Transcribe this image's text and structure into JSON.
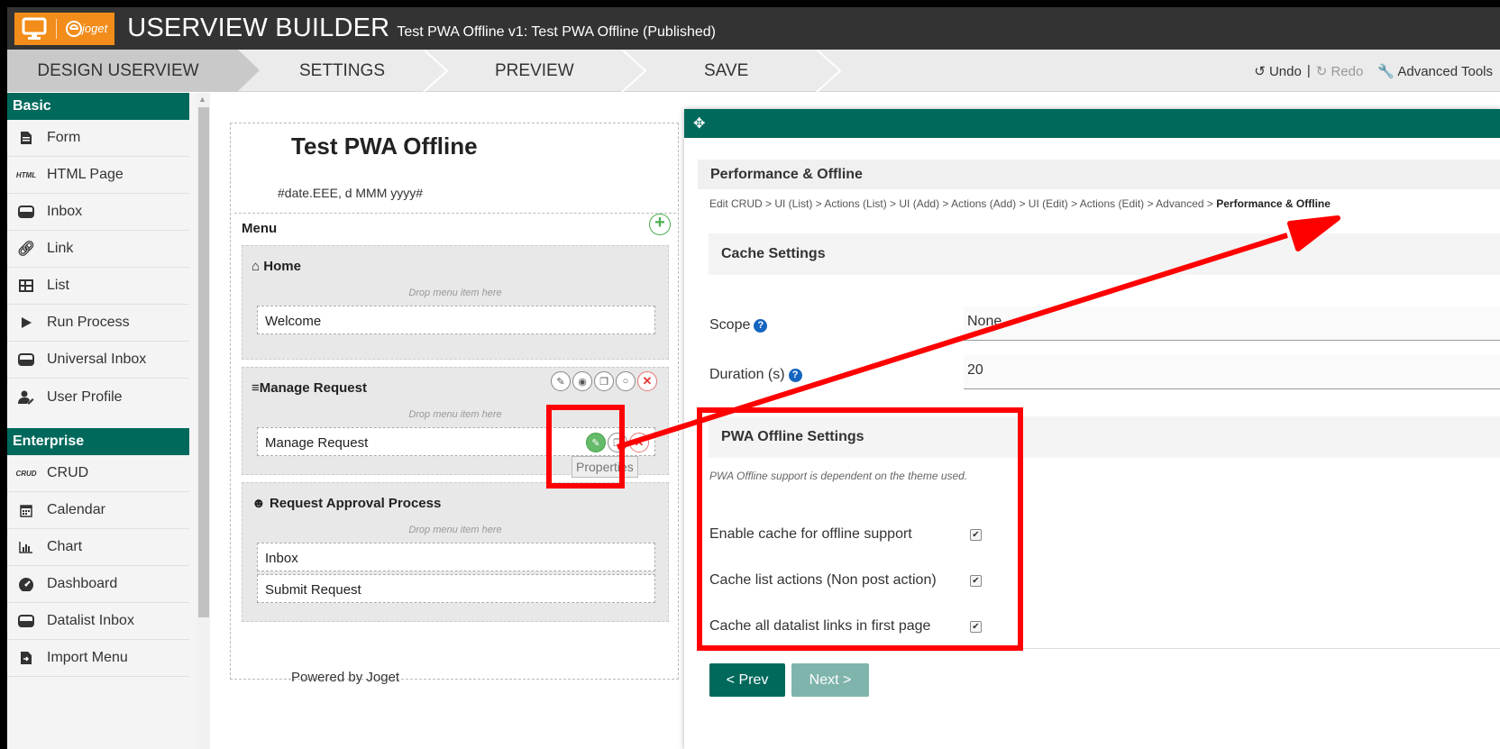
{
  "header": {
    "brand": "joget",
    "title": "USERVIEW BUILDER",
    "subtitle": "Test PWA Offline v1: Test PWA Offline (Published)"
  },
  "steps": [
    "DESIGN USERVIEW",
    "SETTINGS",
    "PREVIEW",
    "SAVE"
  ],
  "tools": {
    "undo": "Undo",
    "separator": "|",
    "redo": "Redo",
    "advanced": "Advanced Tools"
  },
  "palette": {
    "basic_title": "Basic",
    "basic_items": [
      {
        "label": "Form",
        "icon": "form-icon"
      },
      {
        "label": "HTML Page",
        "icon": "html-icon",
        "icon_text": "HTML"
      },
      {
        "label": "Inbox",
        "icon": "inbox-icon"
      },
      {
        "label": "Link",
        "icon": "link-icon"
      },
      {
        "label": "List",
        "icon": "list-icon"
      },
      {
        "label": "Run Process",
        "icon": "play-icon"
      },
      {
        "label": "Universal Inbox",
        "icon": "inbox-icon"
      },
      {
        "label": "User Profile",
        "icon": "user-profile-icon"
      }
    ],
    "enterprise_title": "Enterprise",
    "enterprise_items": [
      {
        "label": "CRUD",
        "icon": "crud-icon",
        "icon_text": "CRUD"
      },
      {
        "label": "Calendar",
        "icon": "calendar-icon"
      },
      {
        "label": "Chart",
        "icon": "chart-icon"
      },
      {
        "label": "Dashboard",
        "icon": "dashboard-icon"
      },
      {
        "label": "Datalist Inbox",
        "icon": "inbox-icon"
      },
      {
        "label": "Import Menu",
        "icon": "import-icon"
      }
    ]
  },
  "canvas": {
    "title": "Test PWA Offline",
    "date": "#date.EEE, d MMM yyyy#",
    "menu_label": "Menu",
    "drop_hint": "Drop menu item here",
    "categories": [
      {
        "title": "Home",
        "items": [
          "Welcome"
        ]
      },
      {
        "title": "Manage Request",
        "items": [
          "Manage Request"
        ]
      },
      {
        "title": "Request Approval Process",
        "items": [
          "Inbox",
          "Submit Request"
        ]
      }
    ],
    "footer": "Powered by Joget",
    "tooltip": "Properties"
  },
  "panel": {
    "section_title": "Performance & Offline",
    "breadcrumb": "Edit CRUD > UI (List) > Actions (List) > UI (Add) > Actions (Add) > UI (Edit) > Actions (Edit) > Advanced > ",
    "breadcrumb_current": "Performance & Offline",
    "cache_title": "Cache Settings",
    "scope_label": "Scope",
    "scope_value": "None",
    "duration_label": "Duration (s)",
    "duration_value": "20",
    "pwa_title": "PWA Offline Settings",
    "pwa_note": "PWA Offline support is dependent on the theme used.",
    "options": [
      {
        "label": "Enable cache for offline support",
        "checked": true
      },
      {
        "label": "Cache list actions (Non post action)",
        "checked": true
      },
      {
        "label": "Cache all datalist links in first page",
        "checked": true
      }
    ],
    "prev": "< Prev",
    "next": "Next >"
  },
  "colors": {
    "accent": "#00695c",
    "header": "#333333",
    "logo": "#f28c1a",
    "annotation": "#ff0000"
  }
}
